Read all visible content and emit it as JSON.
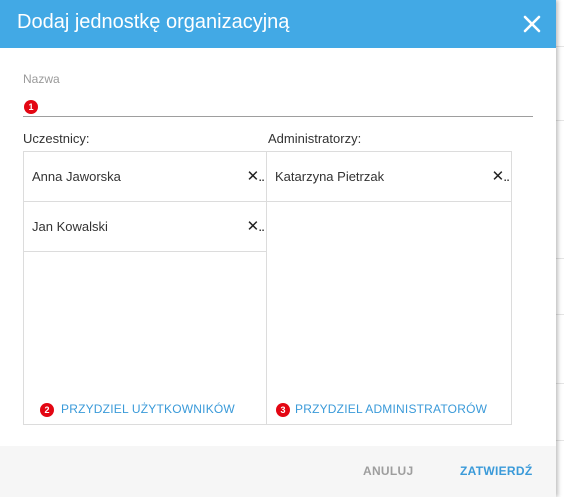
{
  "dialog": {
    "title": "Dodaj jednostkę organizacyjną",
    "close_icon": "close-icon",
    "header_color": "#42a9e5"
  },
  "name_field": {
    "label": "Nazwa",
    "value": "",
    "badge": "1"
  },
  "participants": {
    "label": "Uczestnicy:",
    "items": [
      {
        "name": "Anna Jaworska",
        "remove_label": "✕.."
      },
      {
        "name": "Jan Kowalski",
        "remove_label": "✕.."
      }
    ],
    "assign_badge": "2",
    "assign_label": "PRZYDZIEL UŻYTKOWNIKÓW"
  },
  "administrators": {
    "label": "Administratorzy:",
    "items": [
      {
        "name": "Katarzyna Pietrzak",
        "remove_label": "✕.."
      }
    ],
    "assign_badge": "3",
    "assign_label": "PRZYDZIEL ADMINISTRATORÓW"
  },
  "footer": {
    "cancel_label": "ANULUJ",
    "confirm_label": "ZATWIERDŹ"
  },
  "colors": {
    "accent": "#3a9ad9",
    "badge": "#e30613"
  }
}
